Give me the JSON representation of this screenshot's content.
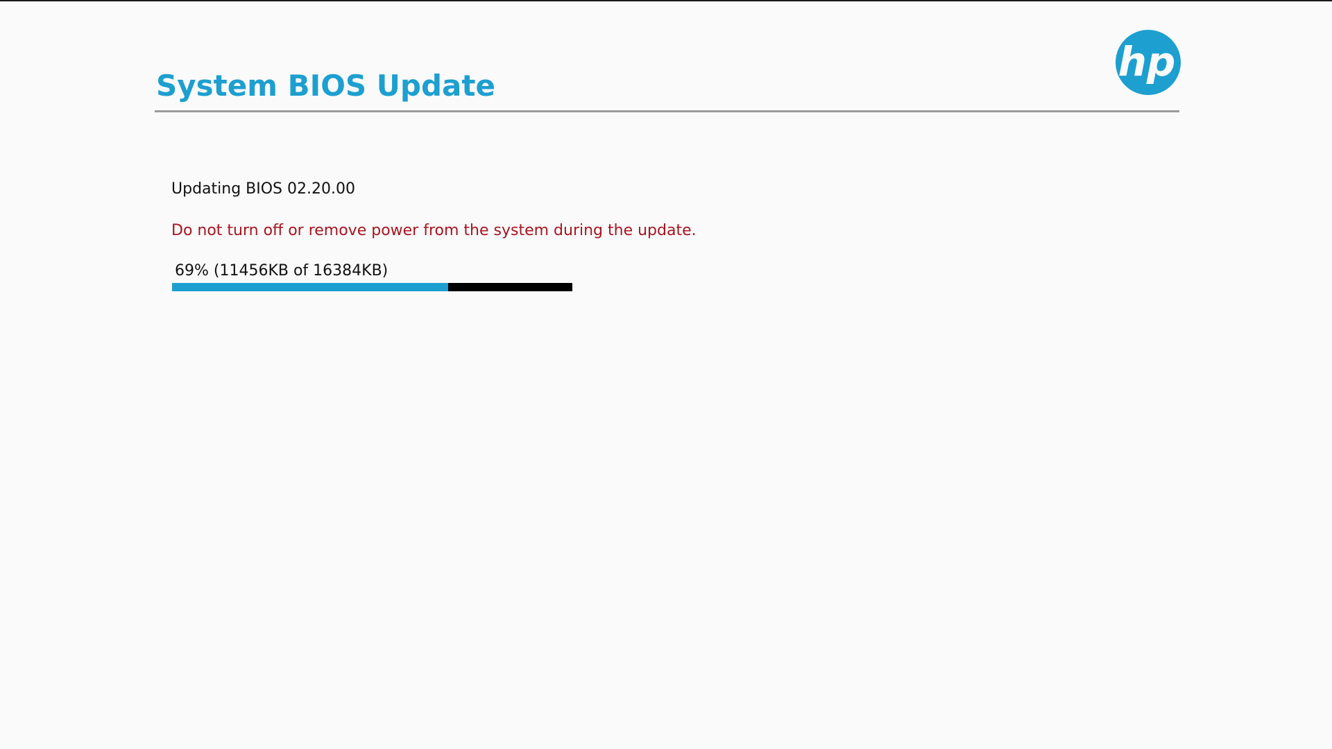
{
  "header": {
    "title": "System BIOS Update",
    "logo_text": "hp",
    "logo_icon": "hp-logo-icon"
  },
  "main": {
    "status_text": "Updating BIOS 02.20.00",
    "warning_text": "Do not turn off or remove power from the system during the update.",
    "progress": {
      "label": "69% (11456KB of 16384KB)",
      "percent": 69,
      "done_kb": 11456,
      "total_kb": 16384
    }
  },
  "colors": {
    "accent": "#1d9fd0",
    "warning": "#a8141e",
    "text": "#111111",
    "divider": "#9a9a9a",
    "track": "#000000",
    "background": "#fafafa"
  }
}
